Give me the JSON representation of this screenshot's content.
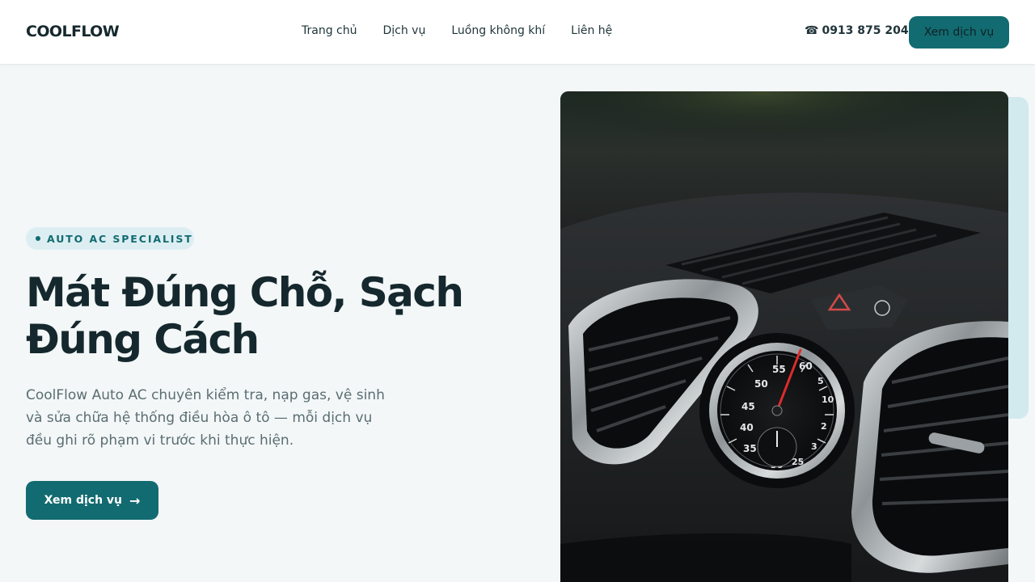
{
  "header": {
    "logo": "COOLFLOW",
    "nav": [
      "Trang chủ",
      "Dịch vụ",
      "Luồng không khí",
      "Liên hệ"
    ],
    "phone_icon": "phone-icon",
    "phone_glyph": "☎",
    "phone": "0913 875 204",
    "cta_label": "Xem dịch vụ"
  },
  "hero": {
    "badge": "AUTO AC SPECIALIST",
    "title_line1": "Mát Đúng Chỗ, Sạch",
    "title_line2": "Đúng Cách",
    "description": "CoolFlow Auto AC chuyên kiểm tra, nạp gas, vệ sinh và sửa chữa hệ thống điều hòa ô tô — mỗi dịch vụ đều ghi rõ phạm vi trước khi thực hiện.",
    "cta_label": "Xem dịch vụ",
    "cta_icon": "arrow-right-icon",
    "cta_arrow": "→",
    "image": {
      "subject": "car-dashboard-air-vents-photo",
      "gauge_labels": [
        "55",
        "60",
        "5",
        "50",
        "45",
        "40",
        "35",
        "10",
        "2",
        "3",
        "25",
        "30"
      ]
    }
  },
  "colors": {
    "accent": "#126b70",
    "background": "#f3f7f8",
    "badge_bg": "#dceef2",
    "text_dark": "#15282d",
    "text_muted": "#5b6d72"
  }
}
